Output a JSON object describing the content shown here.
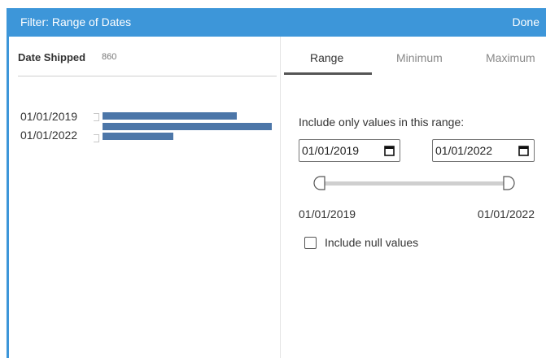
{
  "dialog": {
    "title": "Filter: Range of Dates",
    "done_label": "Done",
    "accent_color": "#3d96d9"
  },
  "field": {
    "name": "Date Shipped",
    "count": "860",
    "histogram": {
      "labels": [
        "01/01/2019",
        "01/01/2022"
      ],
      "bar_color": "#4c76a8",
      "bars": [
        0.78,
        0.98,
        0.41
      ]
    }
  },
  "tabs": [
    {
      "label": "Range",
      "active": true
    },
    {
      "label": "Minimum",
      "active": false
    },
    {
      "label": "Maximum",
      "active": false
    }
  ],
  "range": {
    "instruction": "Include only values in this range:",
    "start_input": "01/01/2019",
    "end_input": "01/01/2022",
    "min_value": "01/01/2019",
    "max_value": "01/01/2022",
    "slider_start": 0,
    "slider_end": 1,
    "include_null_label": "Include null values",
    "include_null_checked": false
  }
}
